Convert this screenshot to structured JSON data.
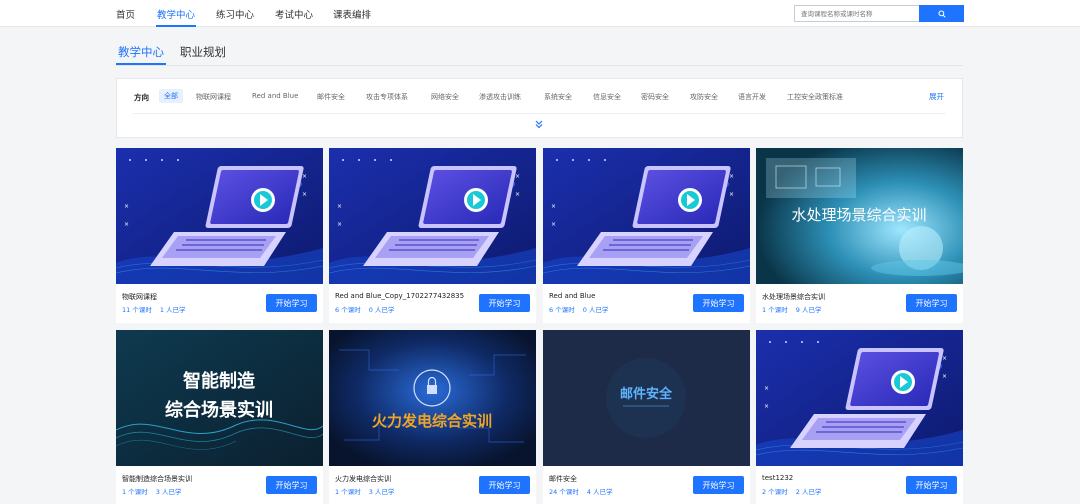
{
  "nav": {
    "items": [
      "首页",
      "教学中心",
      "练习中心",
      "考试中心",
      "课表编排"
    ],
    "active_index": 1,
    "search_placeholder": "查询课程名称或课时名称"
  },
  "subtabs": {
    "items": [
      "教学中心",
      "职业规划"
    ],
    "active_index": 0
  },
  "filter": {
    "label": "方向",
    "chips": [
      "全部",
      "物联网课程",
      "Red and Blue",
      "邮件安全",
      "攻击专项体系",
      "网络安全",
      "渗透攻击训练",
      "系统安全",
      "信息安全",
      "密码安全",
      "攻防安全",
      "语言开发",
      "工控安全政策标准"
    ],
    "active_index": 0,
    "expand_label": "展开"
  },
  "cards": [
    {
      "title": "物联网课程",
      "lessons": "11 个课时",
      "learners": "1 人已学",
      "button": "开始学习",
      "thumb": "laptop"
    },
    {
      "title": "Red and Blue_Copy_1702277432835",
      "lessons": "6 个课时",
      "learners": "0 人已学",
      "button": "开始学习",
      "thumb": "laptop"
    },
    {
      "title": "Red and Blue",
      "lessons": "6 个课时",
      "learners": "0 人已学",
      "button": "开始学习",
      "thumb": "laptop"
    },
    {
      "title": "水处理场景综合实训",
      "lessons": "1 个课时",
      "learners": "9 人已学",
      "button": "开始学习",
      "thumb": "water",
      "thumb_text": "水处理场景综合实训"
    },
    {
      "title": "智能制造综合场景实训",
      "lessons": "1 个课时",
      "learners": "3 人已学",
      "button": "开始学习",
      "thumb": "smart",
      "thumb_text": [
        "智能制造",
        "综合场景实训"
      ]
    },
    {
      "title": "火力发电综合实训",
      "lessons": "1 个课时",
      "learners": "3 人已学",
      "button": "开始学习",
      "thumb": "fire",
      "thumb_text": "火力发电综合实训"
    },
    {
      "title": "邮件安全",
      "lessons": "24 个课时",
      "learners": "4 人已学",
      "button": "开始学习",
      "thumb": "mail",
      "thumb_text": "邮件安全"
    },
    {
      "title": "test1232",
      "lessons": "2 个课时",
      "learners": "2 人已学",
      "button": "开始学习",
      "thumb": "laptop"
    }
  ],
  "colors": {
    "accent": "#1e73ff",
    "laptop_bg": "#1a2fa8",
    "water_bg": "#0f4a63",
    "fire_bg": "#0c1a3a",
    "mail_bg": "#1a2740"
  }
}
